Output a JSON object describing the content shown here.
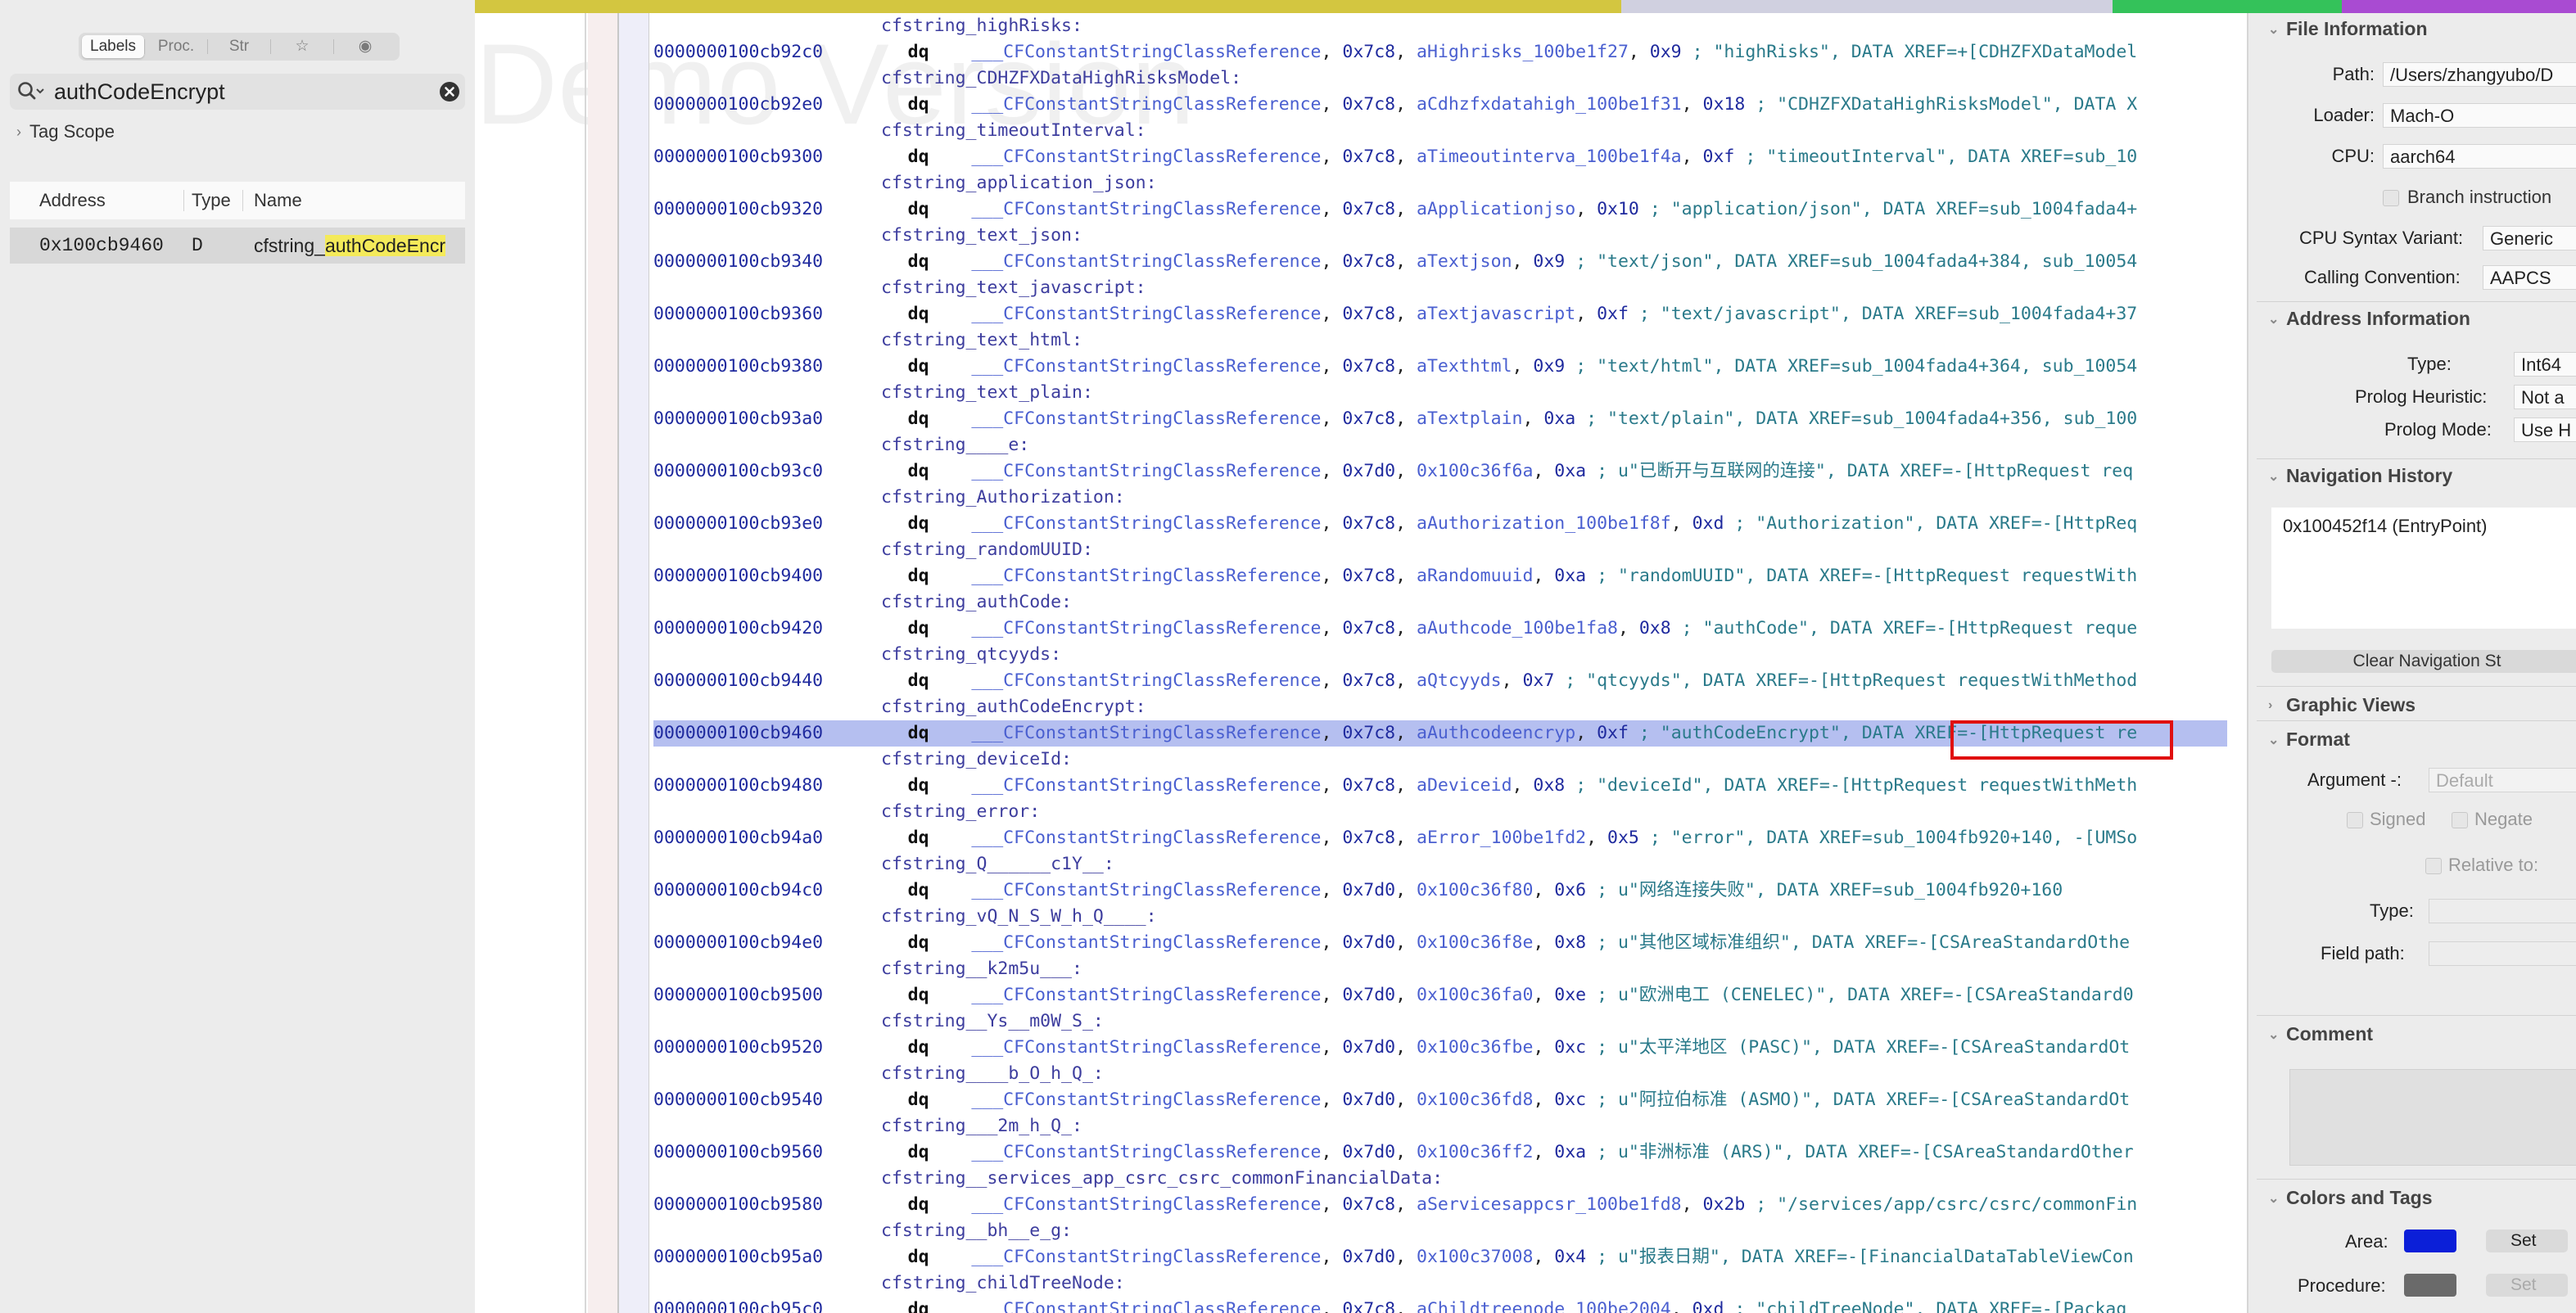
{
  "left_panel": {
    "tabs": [
      "Labels",
      "Proc.",
      "Str",
      "☆",
      "◉"
    ],
    "search_value": "authCodeEncrypt",
    "tag_scope": "Tag Scope",
    "columns": [
      "Address",
      "Type",
      "Name"
    ],
    "result": {
      "address": "0x100cb9460",
      "type": "D",
      "name_prefix": "cfstring_",
      "name_match": "authCodeEncr"
    }
  },
  "watermark": "Demo Version",
  "listing": [
    {
      "kind": "label",
      "text": "cfstring_highRisks:"
    },
    {
      "kind": "code",
      "addr": "0000000100cb92c0",
      "mn": "dq",
      "ref": "___CFConstantStringClassReference",
      "a": "0x7c8",
      "sym": "aHighrisks_100be1f27",
      "n": "0x9",
      "cmt": "; \"highRisks\", DATA XREF=+[CDHZFXDataModel"
    },
    {
      "kind": "label",
      "text": "cfstring_CDHZFXDataHighRisksModel:"
    },
    {
      "kind": "code",
      "addr": "0000000100cb92e0",
      "mn": "dq",
      "ref": "___CFConstantStringClassReference",
      "a": "0x7c8",
      "sym": "aCdhzfxdatahigh_100be1f31",
      "n": "0x18",
      "cmt": "; \"CDHZFXDataHighRisksModel\", DATA X"
    },
    {
      "kind": "label",
      "text": "cfstring_timeoutInterval:"
    },
    {
      "kind": "code",
      "addr": "0000000100cb9300",
      "mn": "dq",
      "ref": "___CFConstantStringClassReference",
      "a": "0x7c8",
      "sym": "aTimeoutinterva_100be1f4a",
      "n": "0xf",
      "cmt": "; \"timeoutInterval\", DATA XREF=sub_10"
    },
    {
      "kind": "label",
      "text": "cfstring_application_json:"
    },
    {
      "kind": "code",
      "addr": "0000000100cb9320",
      "mn": "dq",
      "ref": "___CFConstantStringClassReference",
      "a": "0x7c8",
      "sym": "aApplicationjso",
      "n": "0x10",
      "cmt": "; \"application/json\", DATA XREF=sub_1004fada4+"
    },
    {
      "kind": "label",
      "text": "cfstring_text_json:"
    },
    {
      "kind": "code",
      "addr": "0000000100cb9340",
      "mn": "dq",
      "ref": "___CFConstantStringClassReference",
      "a": "0x7c8",
      "sym": "aTextjson",
      "n": "0x9",
      "cmt": "; \"text/json\", DATA XREF=sub_1004fada4+384, sub_10054"
    },
    {
      "kind": "label",
      "text": "cfstring_text_javascript:"
    },
    {
      "kind": "code",
      "addr": "0000000100cb9360",
      "mn": "dq",
      "ref": "___CFConstantStringClassReference",
      "a": "0x7c8",
      "sym": "aTextjavascript",
      "n": "0xf",
      "cmt": "; \"text/javascript\", DATA XREF=sub_1004fada4+37"
    },
    {
      "kind": "label",
      "text": "cfstring_text_html:"
    },
    {
      "kind": "code",
      "addr": "0000000100cb9380",
      "mn": "dq",
      "ref": "___CFConstantStringClassReference",
      "a": "0x7c8",
      "sym": "aTexthtml",
      "n": "0x9",
      "cmt": "; \"text/html\", DATA XREF=sub_1004fada4+364, sub_10054"
    },
    {
      "kind": "label",
      "text": "cfstring_text_plain:"
    },
    {
      "kind": "code",
      "addr": "0000000100cb93a0",
      "mn": "dq",
      "ref": "___CFConstantStringClassReference",
      "a": "0x7c8",
      "sym": "aTextplain",
      "n": "0xa",
      "cmt": "; \"text/plain\", DATA XREF=sub_1004fada4+356, sub_100"
    },
    {
      "kind": "label",
      "text": "cfstring____e:"
    },
    {
      "kind": "code",
      "addr": "0000000100cb93c0",
      "mn": "dq",
      "ref": "___CFConstantStringClassReference",
      "a": "0x7d0",
      "sym": "0x100c36f6a",
      "n": "0xa",
      "cmt": "; u\"已断开与互联网的连接\", DATA XREF=-[HttpRequest req"
    },
    {
      "kind": "label",
      "text": "cfstring_Authorization:"
    },
    {
      "kind": "code",
      "addr": "0000000100cb93e0",
      "mn": "dq",
      "ref": "___CFConstantStringClassReference",
      "a": "0x7c8",
      "sym": "aAuthorization_100be1f8f",
      "n": "0xd",
      "cmt": "; \"Authorization\", DATA XREF=-[HttpReq"
    },
    {
      "kind": "label",
      "text": "cfstring_randomUUID:"
    },
    {
      "kind": "code",
      "addr": "0000000100cb9400",
      "mn": "dq",
      "ref": "___CFConstantStringClassReference",
      "a": "0x7c8",
      "sym": "aRandomuuid",
      "n": "0xa",
      "cmt": "; \"randomUUID\", DATA XREF=-[HttpRequest requestWith"
    },
    {
      "kind": "label",
      "text": "cfstring_authCode:"
    },
    {
      "kind": "code",
      "addr": "0000000100cb9420",
      "mn": "dq",
      "ref": "___CFConstantStringClassReference",
      "a": "0x7c8",
      "sym": "aAuthcode_100be1fa8",
      "n": "0x8",
      "cmt": "; \"authCode\", DATA XREF=-[HttpRequest reque"
    },
    {
      "kind": "label",
      "text": "cfstring_qtcyyds:"
    },
    {
      "kind": "code",
      "addr": "0000000100cb9440",
      "mn": "dq",
      "ref": "___CFConstantStringClassReference",
      "a": "0x7c8",
      "sym": "aQtcyyds",
      "n": "0x7",
      "cmt": "; \"qtcyyds\", DATA XREF=-[HttpRequest requestWithMethod"
    },
    {
      "kind": "label",
      "text": "cfstring_authCodeEncrypt:"
    },
    {
      "kind": "code",
      "sel": true,
      "addr": "0000000100cb9460",
      "mn": "dq",
      "ref": "___CFConstantStringClassReference",
      "a": "0x7c8",
      "sym": "aAuthcodeencryp",
      "n": "0xf",
      "cmt": "; \"authCodeEncrypt\", DATA XREF=-[HttpRequest re"
    },
    {
      "kind": "label",
      "text": "cfstring_deviceId:"
    },
    {
      "kind": "code",
      "addr": "0000000100cb9480",
      "mn": "dq",
      "ref": "___CFConstantStringClassReference",
      "a": "0x7c8",
      "sym": "aDeviceid",
      "n": "0x8",
      "cmt": "; \"deviceId\", DATA XREF=-[HttpRequest requestWithMeth"
    },
    {
      "kind": "label",
      "text": "cfstring_error:"
    },
    {
      "kind": "code",
      "addr": "0000000100cb94a0",
      "mn": "dq",
      "ref": "___CFConstantStringClassReference",
      "a": "0x7c8",
      "sym": "aError_100be1fd2",
      "n": "0x5",
      "cmt": "; \"error\", DATA XREF=sub_1004fb920+140, -[UMSo"
    },
    {
      "kind": "label",
      "text": "cfstring_Q______c1Y__:"
    },
    {
      "kind": "code",
      "addr": "0000000100cb94c0",
      "mn": "dq",
      "ref": "___CFConstantStringClassReference",
      "a": "0x7d0",
      "sym": "0x100c36f80",
      "n": "0x6",
      "cmt": "; u\"网络连接失败\", DATA XREF=sub_1004fb920+160"
    },
    {
      "kind": "label",
      "text": "cfstring_vQ_N_S_W_h_Q____:"
    },
    {
      "kind": "code",
      "addr": "0000000100cb94e0",
      "mn": "dq",
      "ref": "___CFConstantStringClassReference",
      "a": "0x7d0",
      "sym": "0x100c36f8e",
      "n": "0x8",
      "cmt": "; u\"其他区域标准组织\", DATA XREF=-[CSAreaStandardOthe"
    },
    {
      "kind": "label",
      "text": "cfstring__k2m5u___:"
    },
    {
      "kind": "code",
      "addr": "0000000100cb9500",
      "mn": "dq",
      "ref": "___CFConstantStringClassReference",
      "a": "0x7d0",
      "sym": "0x100c36fa0",
      "n": "0xe",
      "cmt": "; u\"欧洲电工 (CENELEC)\", DATA XREF=-[CSAreaStandard0"
    },
    {
      "kind": "label",
      "text": "cfstring__Ys__m0W_S_:"
    },
    {
      "kind": "code",
      "addr": "0000000100cb9520",
      "mn": "dq",
      "ref": "___CFConstantStringClassReference",
      "a": "0x7d0",
      "sym": "0x100c36fbe",
      "n": "0xc",
      "cmt": "; u\"太平洋地区 (PASC)\", DATA XREF=-[CSAreaStandardOt"
    },
    {
      "kind": "label",
      "text": "cfstring____b_O_h_Q_:"
    },
    {
      "kind": "code",
      "addr": "0000000100cb9540",
      "mn": "dq",
      "ref": "___CFConstantStringClassReference",
      "a": "0x7d0",
      "sym": "0x100c36fd8",
      "n": "0xc",
      "cmt": "; u\"阿拉伯标准 (ASMO)\", DATA XREF=-[CSAreaStandardOt"
    },
    {
      "kind": "label",
      "text": "cfstring___2m_h_Q_:"
    },
    {
      "kind": "code",
      "addr": "0000000100cb9560",
      "mn": "dq",
      "ref": "___CFConstantStringClassReference",
      "a": "0x7d0",
      "sym": "0x100c36ff2",
      "n": "0xa",
      "cmt": "; u\"非洲标准 (ARS)\", DATA XREF=-[CSAreaStandardOther"
    },
    {
      "kind": "label",
      "text": "cfstring__services_app_csrc_csrc_commonFinancialData:"
    },
    {
      "kind": "code",
      "addr": "0000000100cb9580",
      "mn": "dq",
      "ref": "___CFConstantStringClassReference",
      "a": "0x7c8",
      "sym": "aServicesappcsr_100be1fd8",
      "n": "0x2b",
      "cmt": "; \"/services/app/csrc/csrc/commonFin"
    },
    {
      "kind": "label",
      "text": "cfstring__bh__e_g:"
    },
    {
      "kind": "code",
      "addr": "0000000100cb95a0",
      "mn": "dq",
      "ref": "___CFConstantStringClassReference",
      "a": "0x7d0",
      "sym": "0x100c37008",
      "n": "0x4",
      "cmt": "; u\"报表日期\", DATA XREF=-[FinancialDataTableViewCon"
    },
    {
      "kind": "label",
      "text": "cfstring_childTreeNode:"
    },
    {
      "kind": "code",
      "addr": "0000000100cb95c0",
      "mn": "dq",
      "ref": "___CFConstantStringClassReference",
      "a": "0x7c8",
      "sym": "aChildtreenode_100be2004",
      "n": "0xd",
      "cmt": "; \"childTreeNode\", DATA XREF=-[Packag"
    }
  ],
  "inspector": {
    "file_info": {
      "title": "File Information",
      "path_label": "Path:",
      "path_value": "/Users/zhangyubo/D",
      "loader_label": "Loader:",
      "loader_value": "Mach-O",
      "cpu_label": "CPU:",
      "cpu_value": "aarch64",
      "branch_label": "Branch instruction",
      "syntax_label": "CPU Syntax Variant:",
      "syntax_value": "Generic",
      "calling_label": "Calling Convention:",
      "calling_value": "AAPCS"
    },
    "address_info": {
      "title": "Address Information",
      "type_label": "Type:",
      "type_value": "Int64",
      "prolog_h_label": "Prolog Heuristic:",
      "prolog_h_value": "Not a",
      "prolog_m_label": "Prolog Mode:",
      "prolog_m_value": "Use H"
    },
    "nav_history": {
      "title": "Navigation History",
      "item": "0x100452f14 (EntryPoint)",
      "clear_label": "Clear Navigation St"
    },
    "graphic_views": {
      "title": "Graphic Views"
    },
    "format": {
      "title": "Format",
      "argument_label": "Argument -:",
      "argument_value": "Default",
      "signed_label": "Signed",
      "negate_label": "Negate",
      "relative_label": "Relative to:",
      "type_label": "Type:",
      "field_path_label": "Field path:"
    },
    "comment": {
      "title": "Comment"
    },
    "colors_tags": {
      "title": "Colors and Tags",
      "area_label": "Area:",
      "area_color": "#0b1fd8",
      "procedure_label": "Procedure:",
      "procedure_color": "#6a6a6a",
      "set_label": "Set"
    }
  },
  "colors": {
    "selection": "#b5bff0",
    "highlight_box": "#e01010",
    "search_match": "#f4ea5a",
    "address": "#1f2a9e",
    "operand": "#4a5fd0",
    "comment": "#2a7a8a"
  }
}
